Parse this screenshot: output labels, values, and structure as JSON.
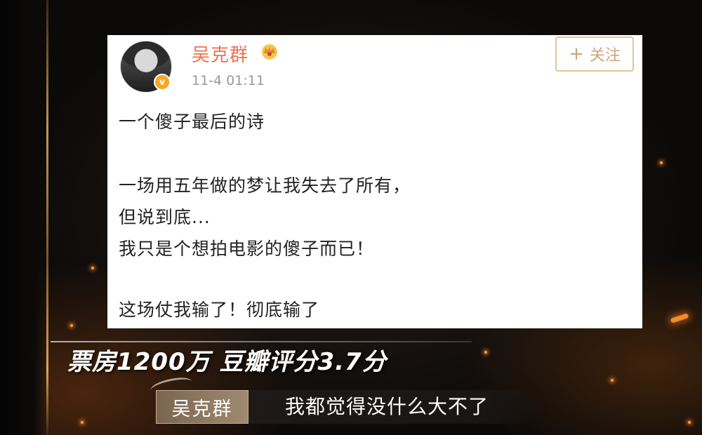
{
  "post": {
    "username": "吴克群",
    "timestamp": "11-4 01:11",
    "verify_badge": "v",
    "follow_label": "关注",
    "follow_icon": "plus-icon",
    "lines": [
      "一个傻子最后的诗",
      "一场用五年做的梦让我失去了所有，",
      "但说到底...",
      "我只是个想拍电影的傻子而已！",
      "这场仗我输了！彻底输了"
    ]
  },
  "caption": {
    "headline": "票房1200万 豆瓣评分3.7分",
    "speaker": "吴克群",
    "subtitle": "我都觉得没什么大不了"
  },
  "colors": {
    "username": "#eb7350",
    "follow_border": "#e0c49b",
    "background": "#1a1512",
    "gold_accent": "#c79b4e"
  }
}
